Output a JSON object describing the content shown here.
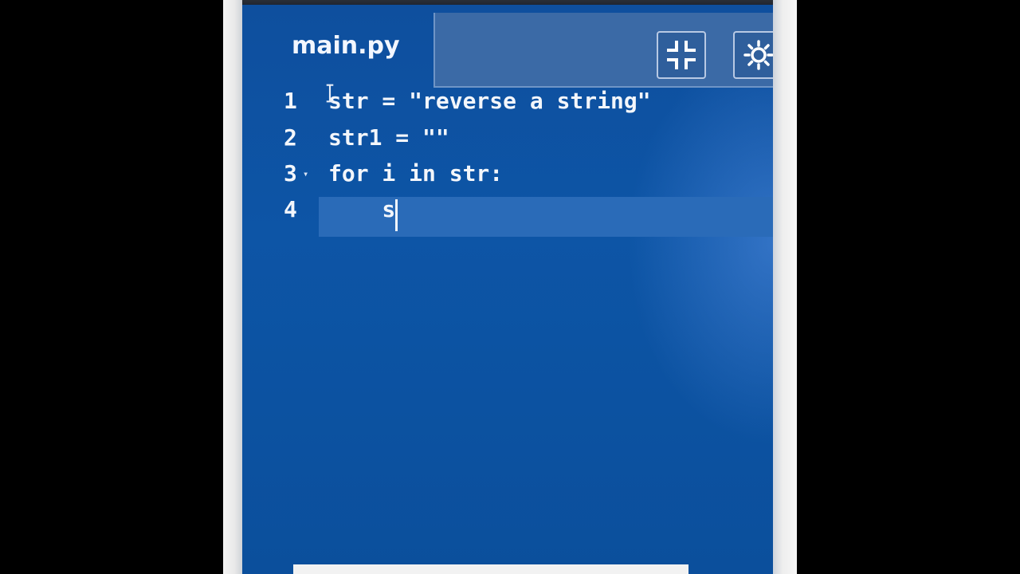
{
  "editor": {
    "tab_title": "main.py",
    "lines": [
      {
        "num": "1",
        "code": "str = \"reverse a string\""
      },
      {
        "num": "2",
        "code": "str1 = \"\""
      },
      {
        "num": "3",
        "code": "for i in str:"
      },
      {
        "num": "4",
        "code": "    s"
      }
    ],
    "fold_marker": "▾"
  },
  "toolbar": {
    "icons": [
      "minimize-icon",
      "theme-toggle-icon"
    ]
  },
  "colors": {
    "editor_background": "#0d55a6",
    "current_line": "#2a6bb8",
    "text": "#f3f6fb"
  }
}
